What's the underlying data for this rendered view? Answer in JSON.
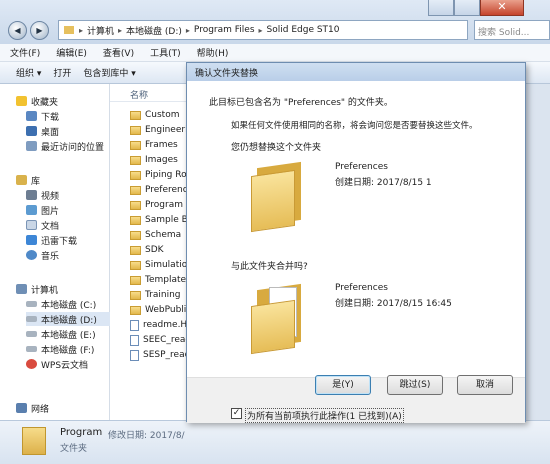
{
  "window": {
    "back": "◀",
    "forward": "▶",
    "close": "✕"
  },
  "address": {
    "crumbs": [
      "计算机",
      "本地磁盘 (D:)",
      "Program Files",
      "Solid Edge ST10"
    ],
    "search_placeholder": "搜索 Solid..."
  },
  "menu": [
    "文件(F)",
    "编辑(E)",
    "查看(V)",
    "工具(T)",
    "帮助(H)"
  ],
  "toolbar": [
    "组织 ▾",
    "打开",
    "包含到库中 ▾"
  ],
  "sidebar": {
    "favorites": "收藏夹",
    "download": "下载",
    "desktop": "桌面",
    "recent": "最近访问的位置",
    "libraries": "库",
    "videos": "视频",
    "pictures": "图片",
    "documents": "文档",
    "thunder": "迅雷下载",
    "music": "音乐",
    "computer": "计算机",
    "drive_c": "本地磁盘 (C:)",
    "drive_d": "本地磁盘 (D:)",
    "drive_e": "本地磁盘 (E:)",
    "drive_f": "本地磁盘 (F:)",
    "wps": "WPS云文档",
    "network": "网络"
  },
  "list": {
    "col_name": "名称",
    "items": [
      "Custom",
      "Engineering",
      "Frames",
      "Images",
      "Piping Ro",
      "Preferenc",
      "Program",
      "Sample Bi",
      "Schema",
      "SDK",
      "Simulation",
      "Template",
      "Training",
      "WebPubli",
      "readme.H",
      "SEEC_read",
      "SESP_read"
    ]
  },
  "details": {
    "name": "Program",
    "modified_label": "修改日期: 2017/8/",
    "type": "文件夹"
  },
  "dialog": {
    "title": "确认文件夹替换",
    "line1": "此目标已包含名为 \"Preferences\" 的文件夹。",
    "line2": "如果任何文件使用相同的名称，将会询问您是否要替换这些文件。",
    "ask_replace": "您仍想替换这个文件夹",
    "folder1_name": "Preferences",
    "folder1_date": "创建日期: 2017/8/15 1",
    "ask_merge": "与此文件夹合并吗?",
    "folder2_name": "Preferences",
    "folder2_date": "创建日期: 2017/8/15 16:45",
    "yes": "是(Y)",
    "skip": "跳过(S)",
    "cancel": "取消",
    "apply_all": "为所有当前项执行此操作(1 已找到)(A)",
    "checkbox_mark": "✓"
  },
  "colors": {
    "accent": "#3c7fb1",
    "folder": "#e8c160",
    "title": "#1e3a6e"
  }
}
